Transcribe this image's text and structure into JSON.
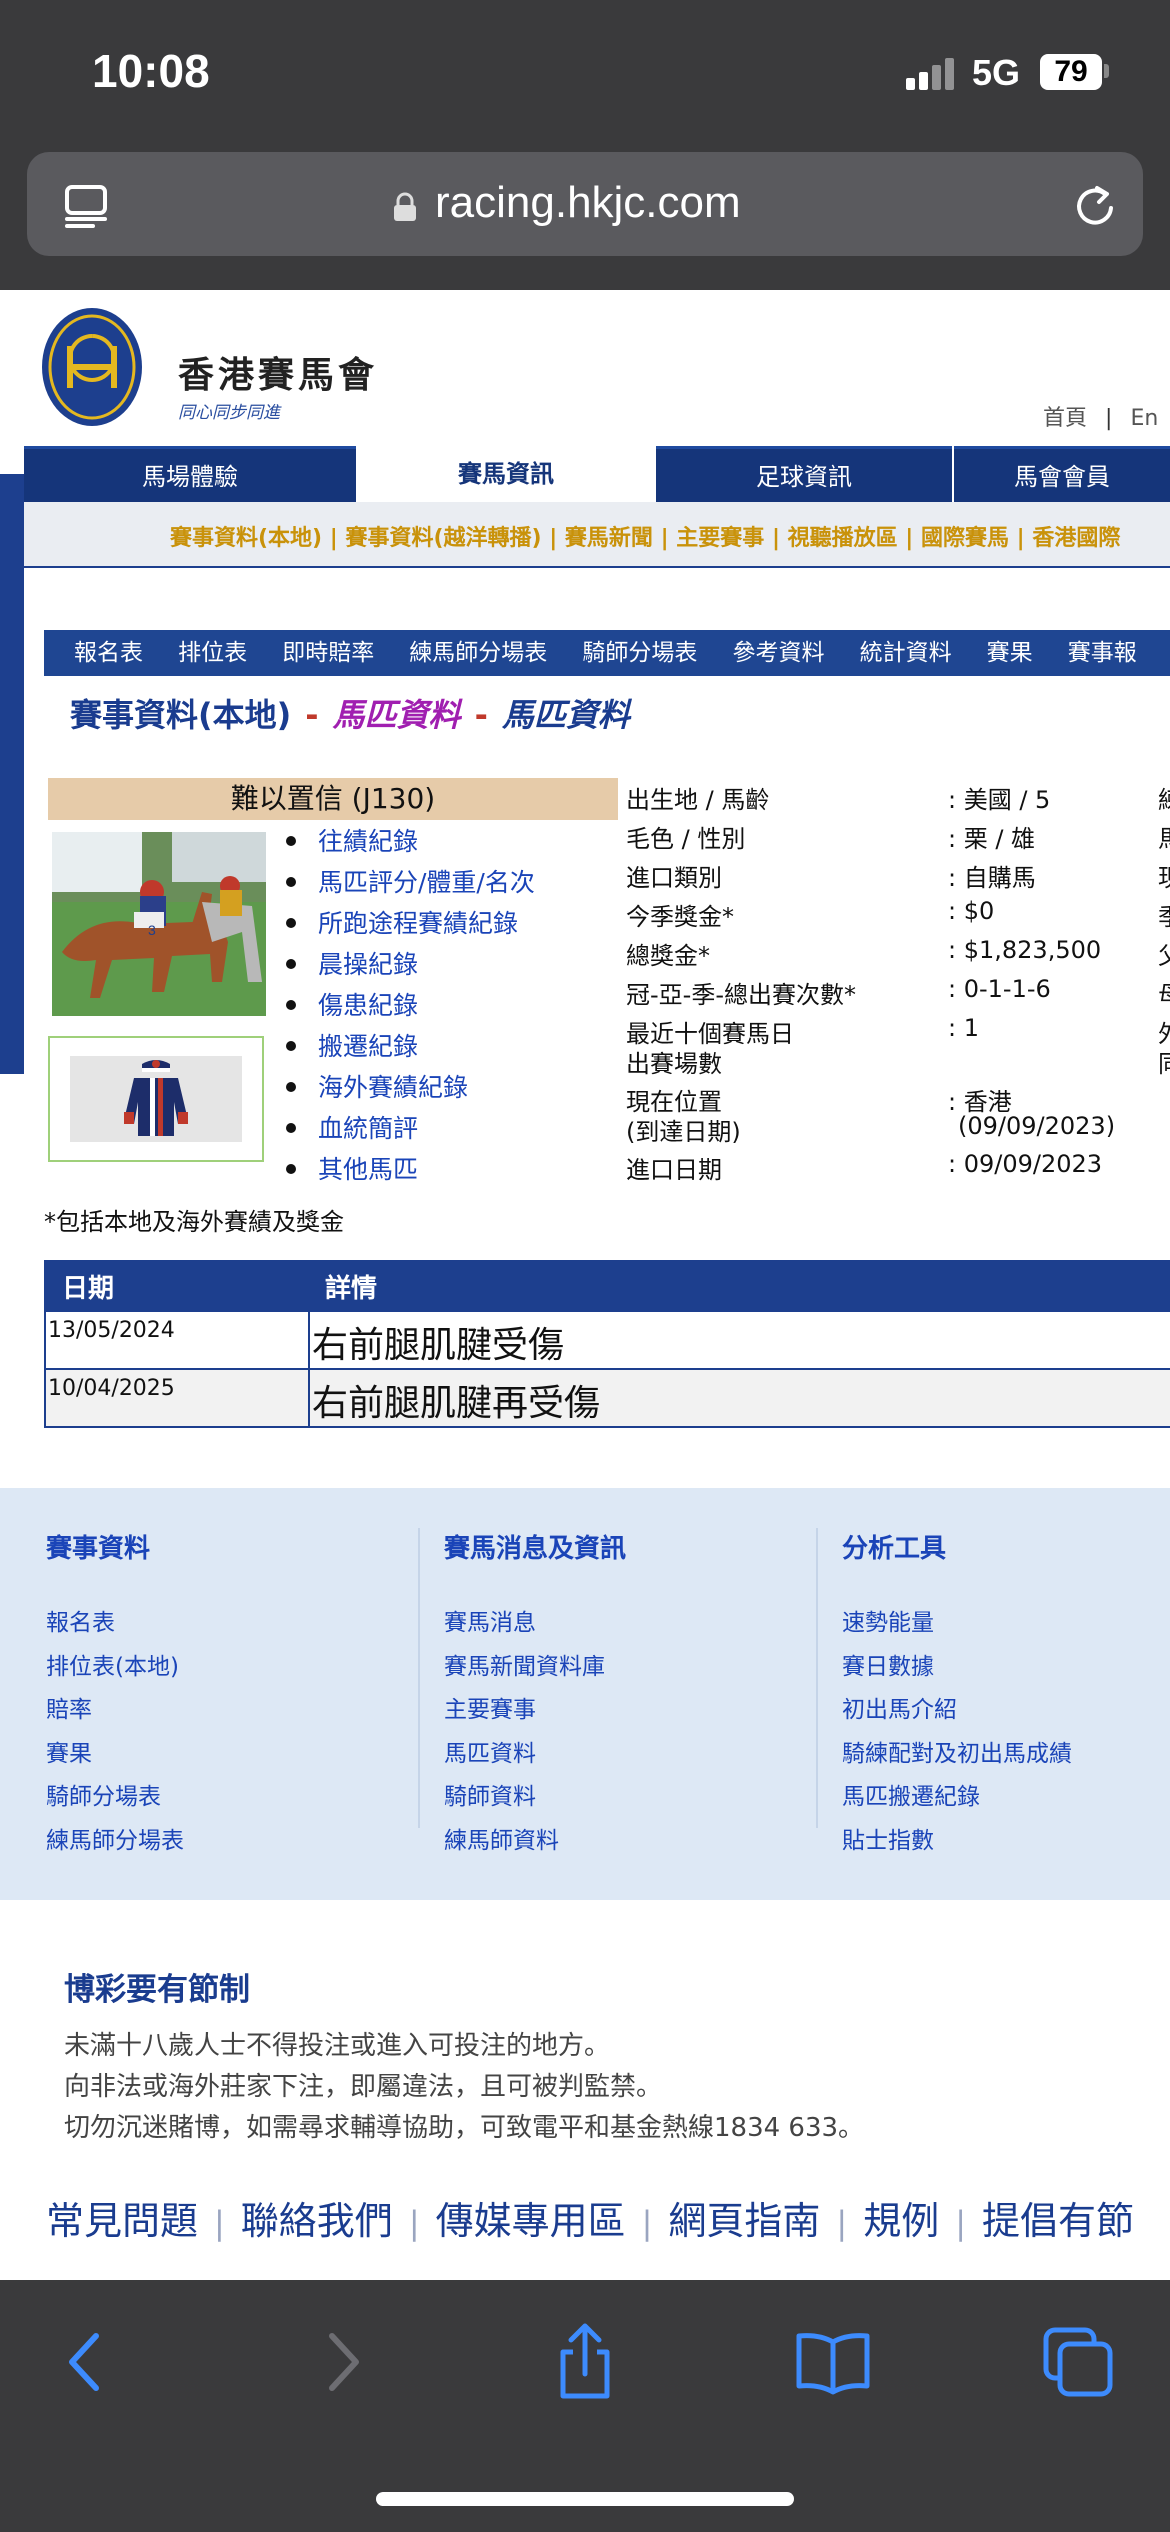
{
  "status_bar": {
    "time": "10:08",
    "network": "5G",
    "battery": "79"
  },
  "browser": {
    "url": "racing.hkjc.com"
  },
  "site": {
    "name": "香港賽馬會",
    "slogan": "同心同步同進",
    "top_links": [
      "首頁",
      "En"
    ]
  },
  "main_nav": {
    "tabs": [
      {
        "label": "馬場體驗",
        "active": false
      },
      {
        "label": "賽馬資訊",
        "active": true
      },
      {
        "label": "足球資訊",
        "active": false
      },
      {
        "label": "馬會會員",
        "active": false
      }
    ]
  },
  "sub_menu": {
    "text": "賽事資料(本地) | 賽事資料(越洋轉播) | 賽馬新聞 | 主要賽事 | 視聽播放區 | 國際賽馬 | 香港國際"
  },
  "section_nav": {
    "items": [
      "報名表",
      "排位表",
      "即時賠率",
      "練馬師分場表",
      "騎師分場表",
      "參考資料",
      "統計資料",
      "賽果",
      "賽事報"
    ]
  },
  "page_title": {
    "main": "賽事資料(本地)",
    "sep": "-",
    "sub1": "馬匹資料",
    "sub2": "馬匹資料"
  },
  "horse": {
    "name": "難以置信 (J130)",
    "links": [
      "往績紀錄",
      "馬匹評分/體重/名次",
      "所跑途程賽績紀錄",
      "晨操紀錄",
      "傷患紀錄",
      "搬遷紀錄",
      "海外賽績紀錄",
      "血統簡評",
      "其他馬匹"
    ],
    "profile": [
      {
        "label": "出生地 / 馬齡",
        "value": ": 美國 / 5",
        "edge": "練"
      },
      {
        "label": "毛色 / 性別",
        "value": ": 栗 / 雄",
        "edge": "馬"
      },
      {
        "label": "進口類別",
        "value": ": 自購馬",
        "edge": "現"
      },
      {
        "label": "今季獎金*",
        "value": ": $0",
        "edge": "季"
      },
      {
        "label": "總獎金*",
        "value": ": $1,823,500",
        "edge": "父"
      },
      {
        "label": "冠-亞-季-總出賽次數*",
        "value": ": 0-1-1-6",
        "edge": "母"
      },
      {
        "label": "最近十個賽馬日",
        "label2": "出賽場數",
        "value": ": 1",
        "edge": "外",
        "edge2": "同"
      },
      {
        "label": "現在位置",
        "label2": "(到達日期)",
        "value": ": 香港",
        "value2": "(09/09/2023)",
        "edge": "",
        "edge2": ""
      },
      {
        "label": "進口日期",
        "value": ": 09/09/2023",
        "edge": ""
      }
    ],
    "footnote": "*包括本地及海外賽績及獎金"
  },
  "injury_table": {
    "headers": [
      "日期",
      "詳情"
    ],
    "rows": [
      {
        "date": "13/05/2024",
        "detail": "右前腿肌腱受傷"
      },
      {
        "date": "10/04/2025",
        "detail": "右前腿肌腱再受傷"
      }
    ]
  },
  "footer_links": {
    "columns": [
      {
        "heading": "賽事資料",
        "items": [
          "報名表",
          "排位表(本地)",
          "賠率",
          "賽果",
          "騎師分場表",
          "練馬師分場表"
        ]
      },
      {
        "heading": "賽馬消息及資訊",
        "items": [
          "賽馬消息",
          "賽馬新聞資料庫",
          "主要賽事",
          "馬匹資料",
          "騎師資料",
          "練馬師資料"
        ]
      },
      {
        "heading": "分析工具",
        "items": [
          "速勢能量",
          "賽日數據",
          "初出馬介紹",
          "騎練配對及初出馬成績",
          "馬匹搬遷紀錄",
          "貼士指數"
        ]
      }
    ]
  },
  "responsible_gambling": {
    "title": "博彩要有節制",
    "lines": [
      "未滿十八歲人士不得投注或進入可投注的地方。",
      "向非法或海外莊家下注，即屬違法，且可被判監禁。",
      "切勿沉迷賭博，如需尋求輔導協助，可致電平和基金熱線1834 633。"
    ]
  },
  "bottom_links": [
    "常見問題",
    "聯絡我們",
    "傳媒專用區",
    "網頁指南",
    "規例",
    "提倡有節"
  ],
  "colors": {
    "navy": "#1d3f8e",
    "link_blue": "#1a44b8",
    "gold": "#c9920a",
    "horse_name_bg": "#e6cba9",
    "footer_bg": "#dde8f5",
    "ios_chrome": "#3a3a3c",
    "ios_blue": "#3d8bfd"
  }
}
